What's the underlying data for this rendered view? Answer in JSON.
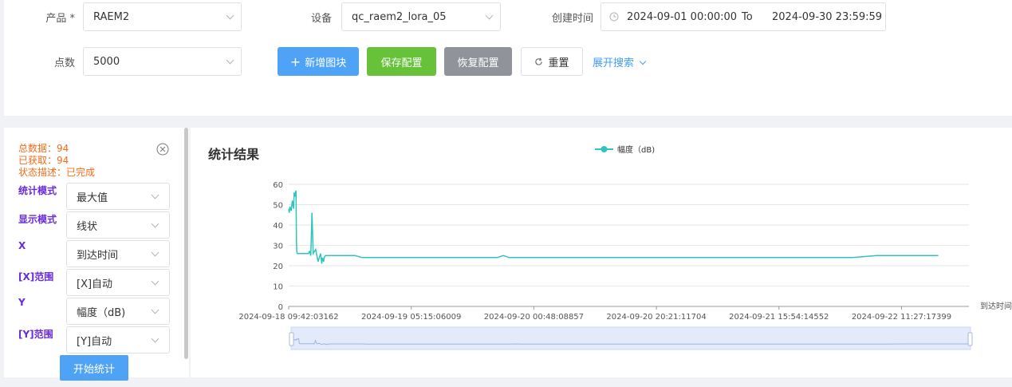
{
  "filters": {
    "product_label": "产品 *",
    "product_value": "RAEM2",
    "device_label": "设备",
    "device_value": "qc_raem2_lora_05",
    "created_label": "创建时间",
    "date_start": "2024-09-01 00:00:00",
    "date_sep": "To",
    "date_end": "2024-09-30 23:59:59",
    "points_label": "点数",
    "points_value": "5000"
  },
  "toolbar": {
    "add_block": "新增图块",
    "save_config": "保存配置",
    "restore_config": "恢复配置",
    "reset": "重置",
    "expand_search": "展开搜索"
  },
  "stats": {
    "total": "总数据：94",
    "fetched": "已获取：94",
    "status": "状态描述：已完成"
  },
  "form": {
    "stat_mode_label": "统计模式",
    "stat_mode_value": "最大值",
    "display_mode_label": "显示模式",
    "display_mode_value": "线状",
    "x_label": "X",
    "x_value": "到达时间",
    "x_range_label": "[X]范围",
    "x_range_value": "[X]自动",
    "y_label": "Y",
    "y_value": "幅度（dB)",
    "y_range_label": "[Y]范围",
    "y_range_value": "[Y]自动",
    "start_button": "开始统计"
  },
  "chart_title": "统计结果",
  "chart_data": {
    "type": "line",
    "title": "统计结果",
    "legend": [
      "幅度（dB)"
    ],
    "legend_position": "top-center",
    "xlabel": "到达时间",
    "ylabel": "",
    "ylim": [
      0,
      60
    ],
    "yticks": [
      0,
      10,
      20,
      30,
      40,
      50,
      60
    ],
    "grid": true,
    "color": "#2ec4c0",
    "x_tick_labels": [
      "2024-09-18 09:42:03162",
      "2024-09-19 05:15:06009",
      "2024-09-20 00:48:08857",
      "2024-09-20 20:21:11704",
      "2024-09-21 15:54:14552",
      "2024-09-22 11:27:17399"
    ],
    "series": [
      {
        "name": "幅度（dB)",
        "t": [
          0,
          0.005,
          0.01,
          0.02,
          0.03,
          0.04,
          0.045,
          0.05,
          0.06,
          0.063,
          0.066,
          0.07,
          0.08,
          0.09,
          0.095,
          0.1,
          0.11,
          0.12,
          0.13,
          0.14,
          0.15,
          0.16,
          0.17,
          0.18,
          0.19,
          0.2,
          0.22,
          0.24,
          0.26,
          0.27,
          0.275,
          0.28,
          0.285,
          0.29,
          0.3,
          0.33,
          0.36,
          0.4,
          0.45,
          0.5,
          0.52,
          0.525,
          0.53,
          0.535,
          0.54,
          0.6,
          0.7,
          0.8,
          0.9,
          1.0,
          1.1,
          1.2,
          1.3,
          1.4,
          1.5,
          1.6,
          1.7,
          1.75,
          1.8,
          1.9,
          2.0,
          2.2,
          2.4,
          2.6,
          2.8,
          3.0,
          3.2,
          3.4,
          3.6,
          3.8,
          4.0,
          4.2,
          4.4,
          4.6,
          4.8,
          5.0,
          5.3
        ],
        "values": [
          48,
          46,
          49,
          47,
          52,
          48,
          56,
          54,
          57,
          33,
          27,
          26,
          26,
          26,
          26,
          26,
          26,
          26,
          26,
          26,
          26,
          26,
          27,
          25,
          46,
          26,
          28,
          22,
          26,
          21,
          24,
          23,
          22,
          24,
          25,
          25,
          25,
          25,
          25,
          25,
          25,
          25,
          25,
          25,
          25,
          24,
          24,
          24,
          24,
          24,
          24,
          24,
          24,
          24,
          24,
          24,
          24,
          25,
          24,
          24,
          24,
          24,
          24,
          24,
          24,
          24,
          24,
          24,
          24,
          24,
          24,
          24,
          24,
          24,
          25,
          25,
          25
        ]
      }
    ]
  }
}
